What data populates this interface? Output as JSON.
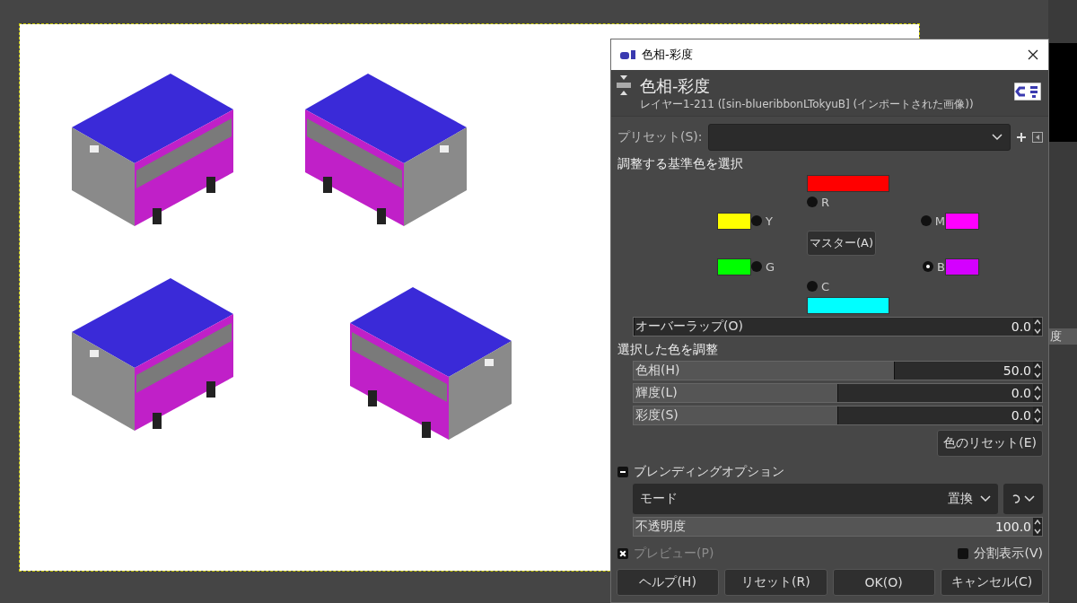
{
  "window": {
    "title": "色相-彩度"
  },
  "header": {
    "title": "色相-彩度",
    "subtitle": "レイヤー1-211 ([sin-blueribbonLTokyuB] (インポートされた画像))"
  },
  "presets": {
    "label": "プリセット(S):"
  },
  "primary_section": {
    "title": "調整する基準色を選択"
  },
  "color_choices": [
    {
      "label": "R",
      "color": "#ff0000",
      "selected": false
    },
    {
      "label": "Y",
      "color": "#ffff00",
      "selected": false
    },
    {
      "label": "M",
      "color": "#ff00ff",
      "selected": false
    },
    {
      "label": "G",
      "color": "#00ff00",
      "selected": false
    },
    {
      "label": "B",
      "color": "#d400ff",
      "selected": true
    },
    {
      "label": "C",
      "color": "#00ffff",
      "selected": false
    }
  ],
  "master_button": "マスター(A)",
  "overlap": {
    "label": "オーバーラップ(O)",
    "reading": "0.0",
    "level": 0
  },
  "adjust_section": {
    "title": "選択した色を調整"
  },
  "sliders": [
    {
      "label": "色相(H)",
      "reading": "50.0",
      "level": 0.64
    },
    {
      "label": "輝度(L)",
      "reading": "0.0",
      "level": 0.5
    },
    {
      "label": "彩度(S)",
      "reading": "0.0",
      "level": 0.5
    }
  ],
  "reset_colors_button": "色のリセット(E)",
  "blending": {
    "title": "ブレンディングオプション",
    "expanded": true,
    "mode_label": "モード",
    "mode_value": "置換",
    "opacity": {
      "label": "不透明度",
      "reading": "100.0",
      "level": 1
    }
  },
  "preview": {
    "label": "プレビュー(P)",
    "checked": true
  },
  "split_view": {
    "label": "分割表示(V)",
    "checked": false
  },
  "buttons": [
    "ヘルプ(H)",
    "リセット(R)",
    "OK(O)",
    "キャンセル(C)"
  ],
  "dock": {
    "partial_text": "度"
  }
}
